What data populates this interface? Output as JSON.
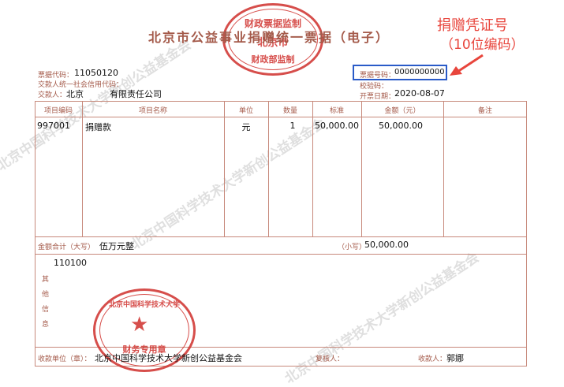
{
  "invoice": {
    "title": "北京市公益事业捐赠统一票据（电子）",
    "code_label": "票据代码：",
    "code_value": "11050120",
    "credit_label": "交款人统一社会信用代码：",
    "payer_label": "交款人：",
    "payer_value": "北京　　　有限责任公司",
    "number_label": "票据号码：",
    "number_value": "0000000000",
    "check_label": "校验码：",
    "date_label": "开票日期：",
    "date_value": "2020-08-07",
    "columns": [
      "项目编码",
      "项目名称",
      "单位",
      "数量",
      "标准",
      "金额（元）",
      "备注"
    ],
    "row": {
      "code": "997001",
      "name": "捐赠款",
      "unit": "元",
      "qty": "1",
      "std": "50,000.00",
      "amount": "50,000.00",
      "note": ""
    },
    "total_label": "金额合计（大写）",
    "total_upper": "伍万元整",
    "small_label": "（小写）",
    "total_lower": "50,000.00",
    "other_info_label": "其他信息",
    "other_info_value": "110100",
    "receiver_label": "收款单位（章）：",
    "receiver_value": "北京中国科学技术大学新创公益基金会",
    "reviewer_label": "复核人：",
    "collector_label": "收款人：",
    "collector_value": "郭娜"
  },
  "annotation": {
    "line1": "捐赠凭证号",
    "line2": "（10位编码）",
    "color": "#e8453c"
  },
  "watermark": "北京中国科学技术大学新创公益基金会",
  "stamps": {
    "top": "北京市财政部监制",
    "bottom": "北京中国科学技术大学新创公益基金会 财务专用章"
  },
  "colors": {
    "label": "#a45a4a",
    "stamp_red": "#d0302c",
    "highlight_box": "#2a5bc8"
  }
}
